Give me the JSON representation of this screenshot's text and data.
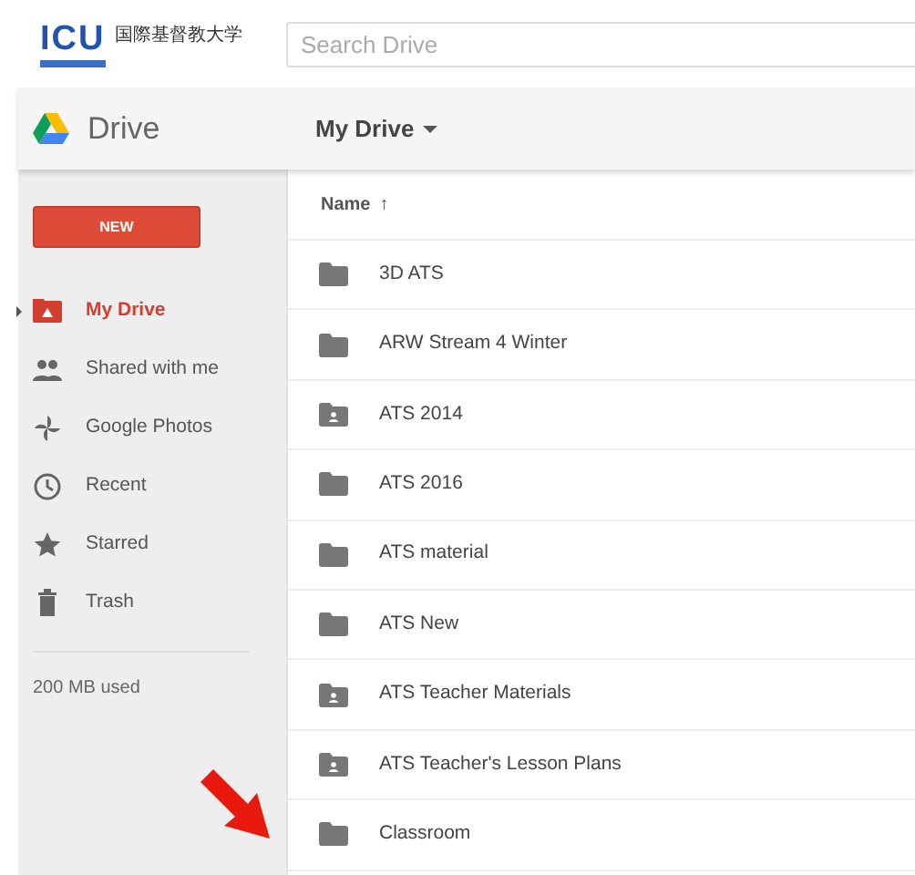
{
  "header": {
    "logo_text": "ICU",
    "logo_subtitle": "国際基督教大学",
    "search": {
      "placeholder": "Search Drive"
    }
  },
  "app_bar": {
    "app_name": "Drive",
    "location": "My Drive"
  },
  "sidebar": {
    "new_button": "NEW",
    "items": [
      {
        "label": "My Drive",
        "kind": "drive",
        "selected": true
      },
      {
        "label": "Shared with me",
        "kind": "people",
        "selected": false
      },
      {
        "label": "Google Photos",
        "kind": "pinwheel",
        "selected": false
      },
      {
        "label": "Recent",
        "kind": "clock",
        "selected": false
      },
      {
        "label": "Starred",
        "kind": "star",
        "selected": false
      },
      {
        "label": "Trash",
        "kind": "trash",
        "selected": false
      }
    ],
    "storage": "200 MB used"
  },
  "table": {
    "columns": [
      {
        "label": "Name",
        "sort": "↑"
      }
    ],
    "rows": [
      {
        "name": "3D ATS",
        "kind": "folder"
      },
      {
        "name": "ARW Stream 4 Winter",
        "kind": "folder"
      },
      {
        "name": "ATS 2014",
        "kind": "shared-folder"
      },
      {
        "name": "ATS 2016",
        "kind": "folder"
      },
      {
        "name": "ATS material",
        "kind": "folder"
      },
      {
        "name": "ATS New",
        "kind": "folder"
      },
      {
        "name": "ATS Teacher Materials",
        "kind": "shared-folder"
      },
      {
        "name": "ATS Teacher's Lesson Plans",
        "kind": "shared-folder"
      },
      {
        "name": "Classroom",
        "kind": "folder"
      }
    ]
  }
}
